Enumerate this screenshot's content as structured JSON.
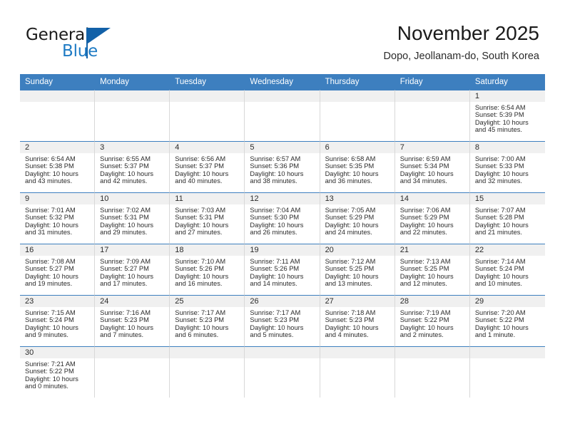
{
  "brand": {
    "name_top": "General",
    "name_bottom": "Blue",
    "flag_icon": "blue-triangle-flag-icon",
    "color_blue": "#1e7bc4",
    "color_dark": "#1b1b1b"
  },
  "header": {
    "title": "November 2025",
    "subtitle": "Dopo, Jeollanam-do, South Korea"
  },
  "theme": {
    "header_row_bg": "#3d7fbf",
    "daynum_band_bg": "#f0f0f0",
    "cell_border": "#d8d8d8",
    "text": "#2b2b2b"
  },
  "weekday_headers": [
    "Sunday",
    "Monday",
    "Tuesday",
    "Wednesday",
    "Thursday",
    "Friday",
    "Saturday"
  ],
  "weeks": [
    [
      {
        "empty": true
      },
      {
        "empty": true
      },
      {
        "empty": true
      },
      {
        "empty": true
      },
      {
        "empty": true
      },
      {
        "empty": true
      },
      {
        "day": "1",
        "sunrise": "Sunrise: 6:54 AM",
        "sunset": "Sunset: 5:39 PM",
        "daylight_line1": "Daylight: 10 hours",
        "daylight_line2": "and 45 minutes."
      }
    ],
    [
      {
        "day": "2",
        "sunrise": "Sunrise: 6:54 AM",
        "sunset": "Sunset: 5:38 PM",
        "daylight_line1": "Daylight: 10 hours",
        "daylight_line2": "and 43 minutes."
      },
      {
        "day": "3",
        "sunrise": "Sunrise: 6:55 AM",
        "sunset": "Sunset: 5:37 PM",
        "daylight_line1": "Daylight: 10 hours",
        "daylight_line2": "and 42 minutes."
      },
      {
        "day": "4",
        "sunrise": "Sunrise: 6:56 AM",
        "sunset": "Sunset: 5:37 PM",
        "daylight_line1": "Daylight: 10 hours",
        "daylight_line2": "and 40 minutes."
      },
      {
        "day": "5",
        "sunrise": "Sunrise: 6:57 AM",
        "sunset": "Sunset: 5:36 PM",
        "daylight_line1": "Daylight: 10 hours",
        "daylight_line2": "and 38 minutes."
      },
      {
        "day": "6",
        "sunrise": "Sunrise: 6:58 AM",
        "sunset": "Sunset: 5:35 PM",
        "daylight_line1": "Daylight: 10 hours",
        "daylight_line2": "and 36 minutes."
      },
      {
        "day": "7",
        "sunrise": "Sunrise: 6:59 AM",
        "sunset": "Sunset: 5:34 PM",
        "daylight_line1": "Daylight: 10 hours",
        "daylight_line2": "and 34 minutes."
      },
      {
        "day": "8",
        "sunrise": "Sunrise: 7:00 AM",
        "sunset": "Sunset: 5:33 PM",
        "daylight_line1": "Daylight: 10 hours",
        "daylight_line2": "and 32 minutes."
      }
    ],
    [
      {
        "day": "9",
        "sunrise": "Sunrise: 7:01 AM",
        "sunset": "Sunset: 5:32 PM",
        "daylight_line1": "Daylight: 10 hours",
        "daylight_line2": "and 31 minutes."
      },
      {
        "day": "10",
        "sunrise": "Sunrise: 7:02 AM",
        "sunset": "Sunset: 5:31 PM",
        "daylight_line1": "Daylight: 10 hours",
        "daylight_line2": "and 29 minutes."
      },
      {
        "day": "11",
        "sunrise": "Sunrise: 7:03 AM",
        "sunset": "Sunset: 5:31 PM",
        "daylight_line1": "Daylight: 10 hours",
        "daylight_line2": "and 27 minutes."
      },
      {
        "day": "12",
        "sunrise": "Sunrise: 7:04 AM",
        "sunset": "Sunset: 5:30 PM",
        "daylight_line1": "Daylight: 10 hours",
        "daylight_line2": "and 26 minutes."
      },
      {
        "day": "13",
        "sunrise": "Sunrise: 7:05 AM",
        "sunset": "Sunset: 5:29 PM",
        "daylight_line1": "Daylight: 10 hours",
        "daylight_line2": "and 24 minutes."
      },
      {
        "day": "14",
        "sunrise": "Sunrise: 7:06 AM",
        "sunset": "Sunset: 5:29 PM",
        "daylight_line1": "Daylight: 10 hours",
        "daylight_line2": "and 22 minutes."
      },
      {
        "day": "15",
        "sunrise": "Sunrise: 7:07 AM",
        "sunset": "Sunset: 5:28 PM",
        "daylight_line1": "Daylight: 10 hours",
        "daylight_line2": "and 21 minutes."
      }
    ],
    [
      {
        "day": "16",
        "sunrise": "Sunrise: 7:08 AM",
        "sunset": "Sunset: 5:27 PM",
        "daylight_line1": "Daylight: 10 hours",
        "daylight_line2": "and 19 minutes."
      },
      {
        "day": "17",
        "sunrise": "Sunrise: 7:09 AM",
        "sunset": "Sunset: 5:27 PM",
        "daylight_line1": "Daylight: 10 hours",
        "daylight_line2": "and 17 minutes."
      },
      {
        "day": "18",
        "sunrise": "Sunrise: 7:10 AM",
        "sunset": "Sunset: 5:26 PM",
        "daylight_line1": "Daylight: 10 hours",
        "daylight_line2": "and 16 minutes."
      },
      {
        "day": "19",
        "sunrise": "Sunrise: 7:11 AM",
        "sunset": "Sunset: 5:26 PM",
        "daylight_line1": "Daylight: 10 hours",
        "daylight_line2": "and 14 minutes."
      },
      {
        "day": "20",
        "sunrise": "Sunrise: 7:12 AM",
        "sunset": "Sunset: 5:25 PM",
        "daylight_line1": "Daylight: 10 hours",
        "daylight_line2": "and 13 minutes."
      },
      {
        "day": "21",
        "sunrise": "Sunrise: 7:13 AM",
        "sunset": "Sunset: 5:25 PM",
        "daylight_line1": "Daylight: 10 hours",
        "daylight_line2": "and 12 minutes."
      },
      {
        "day": "22",
        "sunrise": "Sunrise: 7:14 AM",
        "sunset": "Sunset: 5:24 PM",
        "daylight_line1": "Daylight: 10 hours",
        "daylight_line2": "and 10 minutes."
      }
    ],
    [
      {
        "day": "23",
        "sunrise": "Sunrise: 7:15 AM",
        "sunset": "Sunset: 5:24 PM",
        "daylight_line1": "Daylight: 10 hours",
        "daylight_line2": "and 9 minutes."
      },
      {
        "day": "24",
        "sunrise": "Sunrise: 7:16 AM",
        "sunset": "Sunset: 5:23 PM",
        "daylight_line1": "Daylight: 10 hours",
        "daylight_line2": "and 7 minutes."
      },
      {
        "day": "25",
        "sunrise": "Sunrise: 7:17 AM",
        "sunset": "Sunset: 5:23 PM",
        "daylight_line1": "Daylight: 10 hours",
        "daylight_line2": "and 6 minutes."
      },
      {
        "day": "26",
        "sunrise": "Sunrise: 7:17 AM",
        "sunset": "Sunset: 5:23 PM",
        "daylight_line1": "Daylight: 10 hours",
        "daylight_line2": "and 5 minutes."
      },
      {
        "day": "27",
        "sunrise": "Sunrise: 7:18 AM",
        "sunset": "Sunset: 5:23 PM",
        "daylight_line1": "Daylight: 10 hours",
        "daylight_line2": "and 4 minutes."
      },
      {
        "day": "28",
        "sunrise": "Sunrise: 7:19 AM",
        "sunset": "Sunset: 5:22 PM",
        "daylight_line1": "Daylight: 10 hours",
        "daylight_line2": "and 2 minutes."
      },
      {
        "day": "29",
        "sunrise": "Sunrise: 7:20 AM",
        "sunset": "Sunset: 5:22 PM",
        "daylight_line1": "Daylight: 10 hours",
        "daylight_line2": "and 1 minute."
      }
    ],
    [
      {
        "day": "30",
        "sunrise": "Sunrise: 7:21 AM",
        "sunset": "Sunset: 5:22 PM",
        "daylight_line1": "Daylight: 10 hours",
        "daylight_line2": "and 0 minutes."
      },
      {
        "empty": true
      },
      {
        "empty": true
      },
      {
        "empty": true
      },
      {
        "empty": true
      },
      {
        "empty": true
      },
      {
        "empty": true
      }
    ]
  ]
}
